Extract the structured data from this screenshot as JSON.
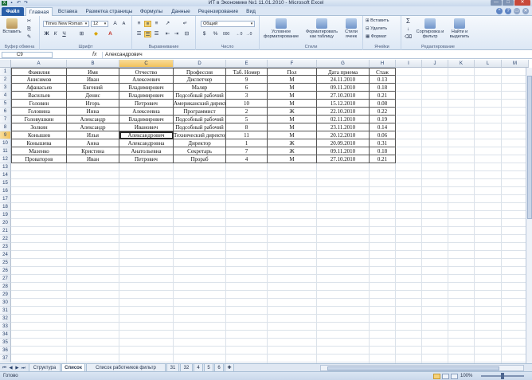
{
  "window": {
    "title": "ИТ в Экономике №1 11.01.2010  -  Microsoft Excel",
    "min": "—",
    "max": "□",
    "close": "✕"
  },
  "tabs": [
    "Файл",
    "Главная",
    "Вставка",
    "Разметка страницы",
    "Формулы",
    "Данные",
    "Рецензирование",
    "Вид"
  ],
  "ribbon": {
    "clipboard": {
      "paste": "Вставить",
      "label": "Буфер обмена"
    },
    "font": {
      "name": "Times New Roman",
      "size": "12",
      "bold": "Ж",
      "italic": "К",
      "underline": "Ч",
      "label": "Шрифт"
    },
    "alignment": {
      "label": "Выравнивание"
    },
    "number": {
      "format": "Общий",
      "percent": "%",
      "thousands": "000",
      "label": "Число"
    },
    "styles": {
      "conditional": "Условное форматирование",
      "as_table": "Форматировать как таблицу",
      "cell_styles": "Стили ячеек",
      "label": "Стили"
    },
    "cells": {
      "insert": "Вставить",
      "delete": "Удалить",
      "format": "Формат",
      "label": "Ячейки"
    },
    "editing": {
      "sum": "Σ",
      "sort": "Сортировка и фильтр",
      "find": "Найти и выделить",
      "label": "Редактирование"
    }
  },
  "formula_bar": {
    "name_box": "C9",
    "fx": "fx",
    "content": "Александрович"
  },
  "columns": [
    "A",
    "B",
    "C",
    "D",
    "E",
    "F",
    "G",
    "H",
    "I",
    "J",
    "K",
    "L",
    "M"
  ],
  "selected_column": "C",
  "selected_row": 9,
  "table": {
    "headers": [
      "Фамилия",
      "Имя",
      "Отчество",
      "Профессия",
      "Таб. Номер",
      "Пол",
      "Дата приема",
      "Стаж"
    ],
    "rows": [
      [
        "Анисимов",
        "Иван",
        "Алексеевич",
        "Диспетчер",
        "9",
        "М",
        "24.11.2010",
        "0.13"
      ],
      [
        "Афанасьев",
        "Евгений",
        "Владимирович",
        "Маляр",
        "6",
        "М",
        "09.11.2010",
        "0.18"
      ],
      [
        "Васильев",
        "Денис",
        "Владимирович",
        "Подсобный рабочий",
        "3",
        "М",
        "27.10.2010",
        "0.21"
      ],
      [
        "Головин",
        "Игорь",
        "Петрович",
        "Американский директор",
        "10",
        "М",
        "15.12.2010",
        "0.08"
      ],
      [
        "Головина",
        "Инна",
        "Алексеевна",
        "Программист",
        "2",
        "Ж",
        "22.10.2010",
        "0.22"
      ],
      [
        "Головушкин",
        "Александр",
        "Владимирович",
        "Подсобный рабочий",
        "5",
        "М",
        "02.11.2010",
        "0.19"
      ],
      [
        "Золкин",
        "Александр",
        "Иванович",
        "Подсобный рабочий",
        "8",
        "М",
        "23.11.2010",
        "0.14"
      ],
      [
        "Конышев",
        "Илья",
        "Александрович",
        "Технический директор",
        "11",
        "М",
        "20.12.2010",
        "0.06"
      ],
      [
        "Конышева",
        "Анна",
        "Александровна",
        "Директор",
        "1",
        "Ж",
        "20.09.2010",
        "0.31"
      ],
      [
        "Мазенко",
        "Кристина",
        "Анатольевна",
        "Секретарь",
        "7",
        "Ж",
        "09.11.2010",
        "0.18"
      ],
      [
        "Проваторов",
        "Иван",
        "Петрович",
        "Прораб",
        "4",
        "М",
        "27.10.2010",
        "0.21"
      ]
    ]
  },
  "row_numbers": [
    "1",
    "2",
    "3",
    "4",
    "5",
    "6",
    "7",
    "8",
    "9",
    "10",
    "11",
    "12",
    "13",
    "14",
    "15",
    "16",
    "17",
    "18",
    "19",
    "20",
    "21",
    "22",
    "23",
    "24",
    "25",
    "26",
    "27",
    "28",
    "29",
    "30",
    "31",
    "32",
    "33",
    "34",
    "35",
    "36",
    "37"
  ],
  "sheets": [
    "Структура",
    "Список",
    "Список работников фильтр",
    "31",
    "32",
    "4",
    "5",
    "6"
  ],
  "active_sheet": "Список",
  "status": {
    "ready": "Готово",
    "zoom": "100%"
  }
}
